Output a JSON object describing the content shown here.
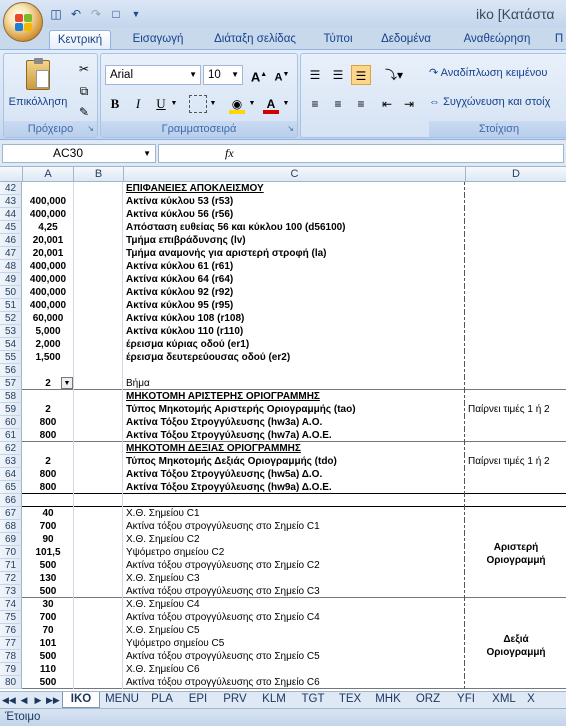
{
  "app": {
    "title": "iko  [Κατάστα"
  },
  "tabs": [
    "Κεντρική",
    "Εισαγωγή",
    "Διάταξη σελίδας",
    "Τύποι",
    "Δεδομένα",
    "Αναθεώρηση",
    "Π"
  ],
  "ribbon": {
    "paste_label": "Επικόλληση",
    "clipboard_label": "Πρόχειρο",
    "font_group_label": "Γραμματοσειρά",
    "alignment_group_label": "Στοίχιση",
    "font_name": "Arial",
    "font_size": "10",
    "bold": "B",
    "italic": "I",
    "underline": "U",
    "wrap_text": "Αναδίπλωση κειμένου",
    "merge_center": "Συγχώνευση και στοίχ",
    "font_color": "#d00000",
    "fill_color": "#ffd700"
  },
  "formula_bar": {
    "name_box": "AC30",
    "fx": "fx",
    "value": ""
  },
  "columns": [
    "A",
    "B",
    "C",
    "D"
  ],
  "rows": [
    {
      "n": "42",
      "a": "",
      "c": "ΕΠΙΦΑΝΕΙΕΣ ΑΠΟΚΛΕΙΣΜΟΥ",
      "cs": "bu",
      "d": ""
    },
    {
      "n": "43",
      "a": "400,000",
      "c": "Ακτίνα κύκλου 53 (r53)",
      "cs": "b",
      "d": ""
    },
    {
      "n": "44",
      "a": "400,000",
      "c": "Ακτίνα κύκλου 56 (r56)",
      "cs": "b",
      "d": ""
    },
    {
      "n": "45",
      "a": "4,25",
      "c": "Απόσταση ευθείας 56 και κύκλου 100 (d56100)",
      "cs": "b",
      "d": ""
    },
    {
      "n": "46",
      "a": "20,001",
      "c": "Τμήμα επιβράδυνσης (lv)",
      "cs": "b",
      "d": ""
    },
    {
      "n": "47",
      "a": "20,001",
      "c": "Τμήμα αναμονής για αριστερή στροφή (la)",
      "cs": "b",
      "d": ""
    },
    {
      "n": "48",
      "a": "400,000",
      "c": "Ακτίνα κύκλου 61 (r61)",
      "cs": "b",
      "d": ""
    },
    {
      "n": "49",
      "a": "400,000",
      "c": "Ακτίνα κύκλου 64 (r64)",
      "cs": "b",
      "d": ""
    },
    {
      "n": "50",
      "a": "400,000",
      "c": "Ακτίνα κύκλου 92 (r92)",
      "cs": "b",
      "d": ""
    },
    {
      "n": "51",
      "a": "400,000",
      "c": "Ακτίνα κύκλου 95 (r95)",
      "cs": "b",
      "d": ""
    },
    {
      "n": "52",
      "a": "60,000",
      "c": "Ακτίνα κύκλου 108 (r108)",
      "cs": "b",
      "d": ""
    },
    {
      "n": "53",
      "a": "5,000",
      "c": "Ακτίνα κύκλου 110 (r110)",
      "cs": "b",
      "d": ""
    },
    {
      "n": "54",
      "a": "2,000",
      "c": "έρεισμα κύριας οδού (er1)",
      "cs": "b",
      "d": ""
    },
    {
      "n": "55",
      "a": "1,500",
      "c": "έρεισμα δευτερεύουσας οδού (er2)",
      "cs": "b",
      "d": ""
    },
    {
      "n": "56",
      "a": "",
      "c": "",
      "cs": "",
      "d": ""
    },
    {
      "n": "57",
      "a": "2",
      "c": "Βήμα",
      "cs": "",
      "d": "",
      "dropdown": true
    },
    {
      "n": "58",
      "a": "",
      "c": "ΜΗΚΟΤΟΜΗ ΑΡΙΣΤΕΡΗΣ ΟΡΙΟΓΡΑΜΜΗΣ",
      "cs": "bu",
      "d": ""
    },
    {
      "n": "59",
      "a": "2",
      "c": "Τύπος Μηκοτομής Αριστερής Οριογραμμής (tao)",
      "cs": "b",
      "d": "Παίρνει τιμές 1 ή 2"
    },
    {
      "n": "60",
      "a": "800",
      "c": "Ακτίνα Τόξου Στρογγύλευσης (hw3a) Α.Ο.",
      "cs": "b",
      "d": ""
    },
    {
      "n": "61",
      "a": "800",
      "c": "Ακτίνα Τόξου Στρογγύλευσης (hw7a) Α.Ο.Ε.",
      "cs": "b",
      "d": ""
    },
    {
      "n": "62",
      "a": "",
      "c": "ΜΗΚΟΤΟΜΗ ΔΕΞΙΑΣ ΟΡΙΟΓΡΑΜΜΗΣ",
      "cs": "bu",
      "d": ""
    },
    {
      "n": "63",
      "a": "2",
      "c": "Τύπος Μηκοτομής Δεξιάς Οριογραμμής (tdo)",
      "cs": "b",
      "d": "Παίρνει τιμές 1 ή 2"
    },
    {
      "n": "64",
      "a": "800",
      "c": "Ακτίνα Τόξου Στρογγύλευσης (hw5a) Δ.Ο.",
      "cs": "b",
      "d": ""
    },
    {
      "n": "65",
      "a": "800",
      "c": "Ακτίνα Τόξου Στρογγύλευσης (hw9a) Δ.Ο.Ε.",
      "cs": "b",
      "d": ""
    },
    {
      "n": "66",
      "a": "",
      "c": "",
      "cs": "",
      "d": ""
    },
    {
      "n": "67",
      "a": "40",
      "c": "Χ.Θ. Σημείου C1",
      "cs": "",
      "d": ""
    },
    {
      "n": "68",
      "a": "700",
      "c": "Ακτίνα τόξου στρογγύλευσης στο Σημείο C1",
      "cs": "",
      "d": ""
    },
    {
      "n": "69",
      "a": "90",
      "c": "Χ.Θ. Σημείου C2",
      "cs": "",
      "d": ""
    },
    {
      "n": "70",
      "a": "101,5",
      "c": "Υψόμετρο σημείου C2",
      "cs": "",
      "d": ""
    },
    {
      "n": "71",
      "a": "500",
      "c": "Ακτίνα τόξου στρογγύλευσης στο Σημείο C2",
      "cs": "",
      "d": ""
    },
    {
      "n": "72",
      "a": "130",
      "c": "Χ.Θ. Σημείου C3",
      "cs": "",
      "d": ""
    },
    {
      "n": "73",
      "a": "500",
      "c": "Ακτίνα τόξου στρογγύλευσης στο Σημείο C3",
      "cs": "",
      "d": ""
    },
    {
      "n": "74",
      "a": "30",
      "c": "Χ.Θ. Σημείου C4",
      "cs": "",
      "d": ""
    },
    {
      "n": "75",
      "a": "700",
      "c": "Ακτίνα τόξου στρογγύλευσης στο Σημείο C4",
      "cs": "",
      "d": ""
    },
    {
      "n": "76",
      "a": "70",
      "c": "Χ.Θ. Σημείου C5",
      "cs": "",
      "d": ""
    },
    {
      "n": "77",
      "a": "101",
      "c": "Υψόμετρο σημείου C5",
      "cs": "",
      "d": ""
    },
    {
      "n": "78",
      "a": "500",
      "c": "Ακτίνα τόξου στρογγύλευσης στο Σημείο C5",
      "cs": "",
      "d": ""
    },
    {
      "n": "79",
      "a": "110",
      "c": "Χ.Θ. Σημείου C6",
      "cs": "",
      "d": ""
    },
    {
      "n": "80",
      "a": "500",
      "c": "Ακτίνα τόξου στρογγύλευσης στο Σημείο C6",
      "cs": "",
      "d": ""
    }
  ],
  "d_labels": {
    "left_line": "Αριστερή\nΟριογραμμή",
    "right_line": "Δεξιά\nΟριογραμμή"
  },
  "sheets": [
    "IKO",
    "MENU",
    "PLA",
    "EPI",
    "PRV",
    "KLM",
    "TGT",
    "TEX",
    "MHK",
    "ORZ",
    "YFI",
    "XML",
    "X"
  ],
  "status": "Έτοιμο"
}
